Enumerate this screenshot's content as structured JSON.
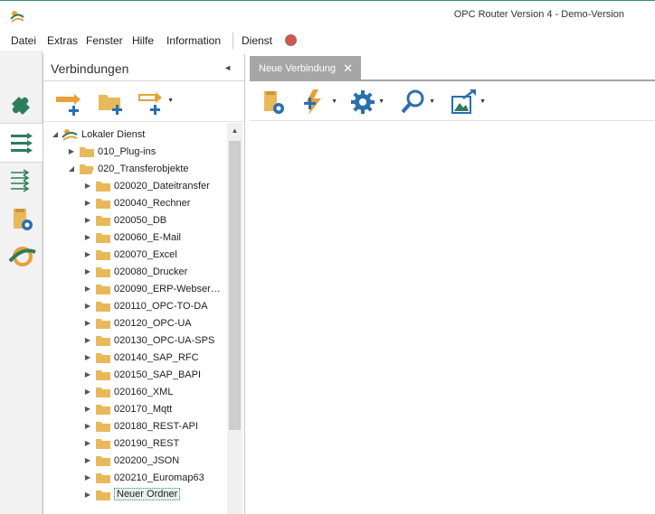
{
  "window": {
    "title": "OPC Router Version 4 - Demo-Version"
  },
  "menu": {
    "items": [
      "Datei",
      "Extras",
      "Fenster",
      "Hilfe",
      "Information",
      "Dienst"
    ]
  },
  "connections_panel": {
    "title": "Verbindungen",
    "collapse_glyph": "◄"
  },
  "tree": {
    "root": "Lokaler Dienst",
    "nodes": [
      "010_Plug-ins",
      "020_Transferobjekte",
      "020020_Dateitransfer",
      "020040_Rechner",
      "020050_DB",
      "020060_E-Mail",
      "020070_Excel",
      "020080_Drucker",
      "020090_ERP-Webser…",
      "020110_OPC-TO-DA",
      "020120_OPC-UA",
      "020130_OPC-UA-SPS",
      "020140_SAP_RFC",
      "020150_SAP_BAPI",
      "020160_XML",
      "020170_Mqtt",
      "020180_REST-API",
      "020190_REST",
      "020200_JSON",
      "020210_Euromap63",
      "Neuer Ordner"
    ]
  },
  "document": {
    "tab_label": "Neue Verbindung",
    "tab_close": "✕"
  },
  "icons": {
    "leftbar": [
      "plugin-icon",
      "connections-icon",
      "transfer-icon",
      "service-settings-icon",
      "opc-router-icon"
    ],
    "panel_tools": [
      "add-connection-icon",
      "add-folder-icon",
      "add-template-icon"
    ],
    "doc_tools": [
      "connection-settings-icon",
      "add-plugin-icon",
      "settings-icon",
      "search-icon",
      "export-image-icon"
    ]
  },
  "colors": {
    "accent_green": "#2e7d5b",
    "folder": "#e8b95a",
    "icon_blue": "#2a6fb0",
    "status_dot": "#d9534f",
    "tab_bg": "#a6a6a6"
  }
}
